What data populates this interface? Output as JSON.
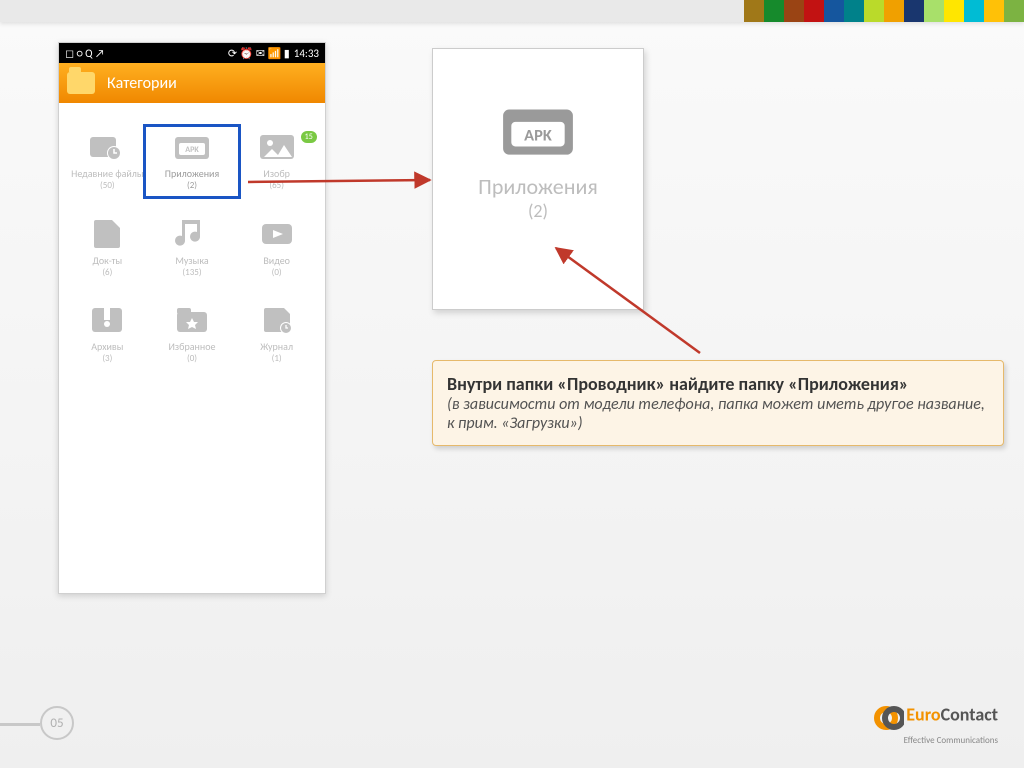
{
  "ribbon_colors": [
    "#a07818",
    "#168a2c",
    "#9a4414",
    "#c21212",
    "#15569e",
    "#00818a",
    "#bada2a",
    "#f0a000",
    "#19366e",
    "#a8e06a",
    "#ffe600",
    "#00bcd4",
    "#ffc107",
    "#7cb342"
  ],
  "statusbar": {
    "left_icons": "◻ ○ Q ↗",
    "right_icons": "⟳ ⏰ ✉ 📶 ▮",
    "time": "14:33"
  },
  "appbar": {
    "title": "Категории"
  },
  "categories": [
    {
      "label": "Недавние файлы",
      "count": "(50)",
      "icon": "recent"
    },
    {
      "label": "Приложения",
      "count": "(2)",
      "icon": "apk",
      "selected": true
    },
    {
      "label": "Изобр",
      "count": "(65)",
      "icon": "image",
      "badge": "15"
    },
    {
      "label": "Док-ты",
      "count": "(6)",
      "icon": "doc"
    },
    {
      "label": "Музыка",
      "count": "(135)",
      "icon": "music"
    },
    {
      "label": "Видео",
      "count": "(0)",
      "icon": "video"
    },
    {
      "label": "Архивы",
      "count": "(3)",
      "icon": "archive"
    },
    {
      "label": "Избранное",
      "count": "(0)",
      "icon": "fav"
    },
    {
      "label": "Журнал",
      "count": "(1)",
      "icon": "journal"
    }
  ],
  "bigtile": {
    "label": "Приложения",
    "count": "(2)"
  },
  "callout": {
    "line1": "Внутри папки «Проводник» найдите папку «Приложения»",
    "line2": "(в зависимости от модели телефона, папка может иметь другое название, к прим. «Загрузки»)"
  },
  "page_number": "05",
  "brand": {
    "part1": "Euro",
    "part2": "Contact",
    "tag": "Effective Communications"
  }
}
